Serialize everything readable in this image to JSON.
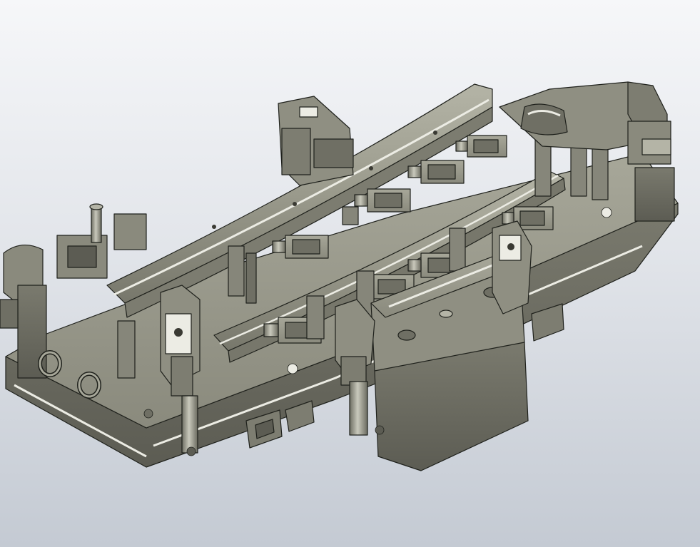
{
  "viewport": {
    "background_top": "#f6f7f9",
    "background_bottom": "#c4cad3",
    "model_color": "#8f8f82",
    "model_dark": "#6f6f64",
    "model_light": "#aeae9f",
    "edge_color": "#1f211c",
    "highlight": "#ecece4"
  },
  "model": {
    "icon": "welding-fixture-assembly-icon",
    "clamp_count": 12,
    "lifting_eyes": 2
  }
}
